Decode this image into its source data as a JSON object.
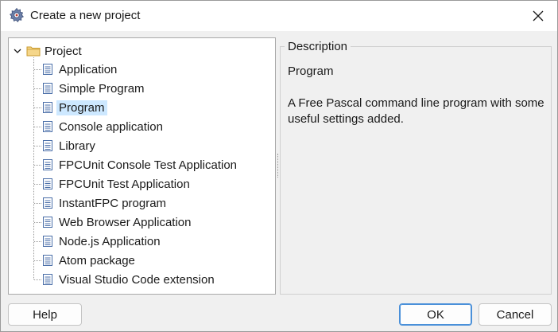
{
  "window": {
    "title": "Create a new project",
    "icon": "gear-icon",
    "close_icon": "close-icon"
  },
  "tree": {
    "root": {
      "label": "Project",
      "icon": "folder-icon",
      "expanded": true
    },
    "items": [
      {
        "label": "Application",
        "icon": "document-icon",
        "selected": false
      },
      {
        "label": "Simple Program",
        "icon": "document-icon",
        "selected": false
      },
      {
        "label": "Program",
        "icon": "document-icon",
        "selected": true
      },
      {
        "label": "Console application",
        "icon": "document-icon",
        "selected": false
      },
      {
        "label": "Library",
        "icon": "document-icon",
        "selected": false
      },
      {
        "label": "FPCUnit Console Test Application",
        "icon": "document-icon",
        "selected": false
      },
      {
        "label": "FPCUnit Test Application",
        "icon": "document-icon",
        "selected": false
      },
      {
        "label": "InstantFPC program",
        "icon": "document-icon",
        "selected": false
      },
      {
        "label": "Web Browser Application",
        "icon": "document-icon",
        "selected": false
      },
      {
        "label": "Node.js Application",
        "icon": "document-icon",
        "selected": false
      },
      {
        "label": "Atom package",
        "icon": "document-icon",
        "selected": false
      },
      {
        "label": "Visual Studio Code extension",
        "icon": "document-icon",
        "selected": false
      }
    ]
  },
  "description": {
    "legend": "Description",
    "name": "Program",
    "text": "A Free Pascal command line program with some useful settings added."
  },
  "buttons": {
    "help": "Help",
    "ok": "OK",
    "cancel": "Cancel"
  },
  "colors": {
    "selection": "#cde8ff",
    "default_button_border": "#4a90d9",
    "folder": "#e8c26a"
  }
}
